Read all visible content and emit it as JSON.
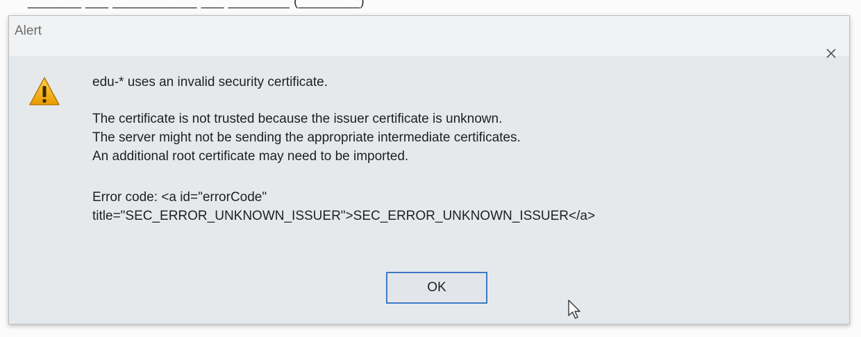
{
  "window": {
    "title": "Alert",
    "close_glyph": "×",
    "close_icon": "close-icon"
  },
  "alert": {
    "icon": "warning-icon",
    "icon_color": "#f2a900",
    "headline": "edu-* uses an invalid security certificate.",
    "details": [
      "The certificate is not trusted because the issuer certificate is unknown.",
      "The server might not be sending the appropriate intermediate certificates.",
      "An additional root certificate may need to be imported."
    ],
    "error_code_line1": "Error code: <a id=\"errorCode\"",
    "error_code_line2": "title=\"SEC_ERROR_UNKNOWN_ISSUER\">SEC_ERROR_UNKNOWN_ISSUER</a>"
  },
  "buttons": {
    "ok_label": "OK",
    "accent_color": "#3d7ac4"
  },
  "cursor": {
    "icon": "mouse-pointer-icon"
  }
}
